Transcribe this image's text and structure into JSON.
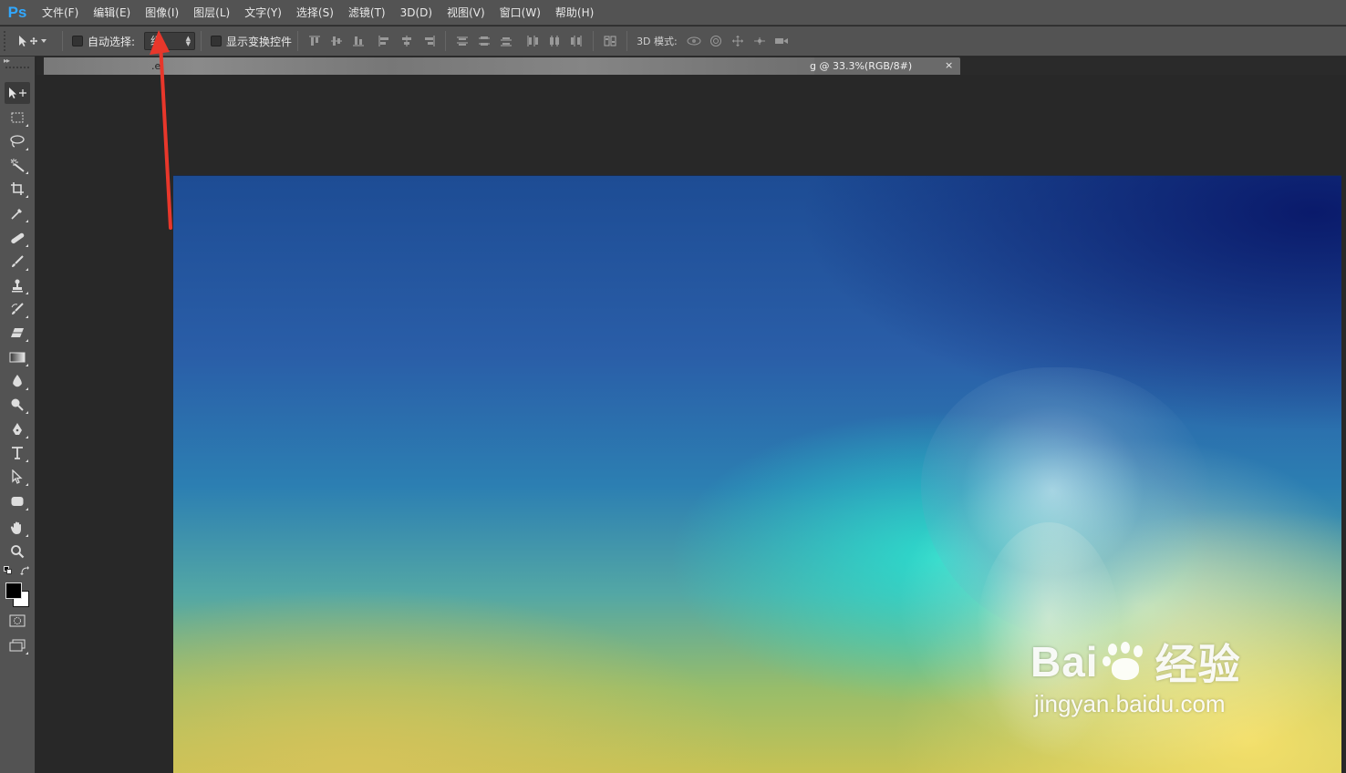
{
  "app": {
    "logo": "Ps",
    "accent": "#31a8ff"
  },
  "menu": [
    "文件(F)",
    "编辑(E)",
    "图像(I)",
    "图层(L)",
    "文字(Y)",
    "选择(S)",
    "滤镜(T)",
    "3D(D)",
    "视图(V)",
    "窗口(W)",
    "帮助(H)"
  ],
  "options": {
    "auto_select_label": "自动选择:",
    "auto_select_value": "组",
    "show_transform_label": "显示变换控件",
    "mode_3d_label": "3D 模式:"
  },
  "document": {
    "tab_fragment": ".e",
    "tab_title": "g @ 33.3%(RGB/8#)",
    "close_glyph": "×"
  },
  "tools": [
    "move-tool",
    "rect-marquee-tool",
    "lasso-tool",
    "magic-wand-tool",
    "crop-tool",
    "eyedropper-tool",
    "healing-brush-tool",
    "brush-tool",
    "clone-stamp-tool",
    "history-brush-tool",
    "eraser-tool",
    "gradient-tool",
    "blur-tool",
    "dodge-tool",
    "pen-tool",
    "type-tool",
    "path-select-tool",
    "shape-tool",
    "hand-tool",
    "zoom-tool"
  ],
  "colors": {
    "foreground": "#000000",
    "background": "#ffffff",
    "annotation": "#e8372b"
  },
  "watermark": {
    "brand_left": "Bai",
    "brand_right": "经验",
    "url": "jingyan.baidu.com"
  }
}
